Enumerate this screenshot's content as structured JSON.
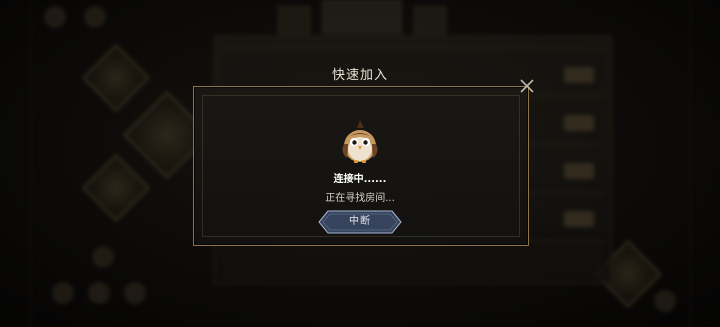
{
  "dialog": {
    "title": "快速加入",
    "status_main": "连接中......",
    "status_sub": "正在寻找房间...",
    "stop_label": "中断",
    "close_icon": "close-icon",
    "mascot_icon": "owl-mascot-icon"
  },
  "colors": {
    "dialog_border": "#8c7448",
    "button_fill": "#3b4a66",
    "button_border": "#a9b7cf",
    "title_text": "#e9e4d6"
  }
}
